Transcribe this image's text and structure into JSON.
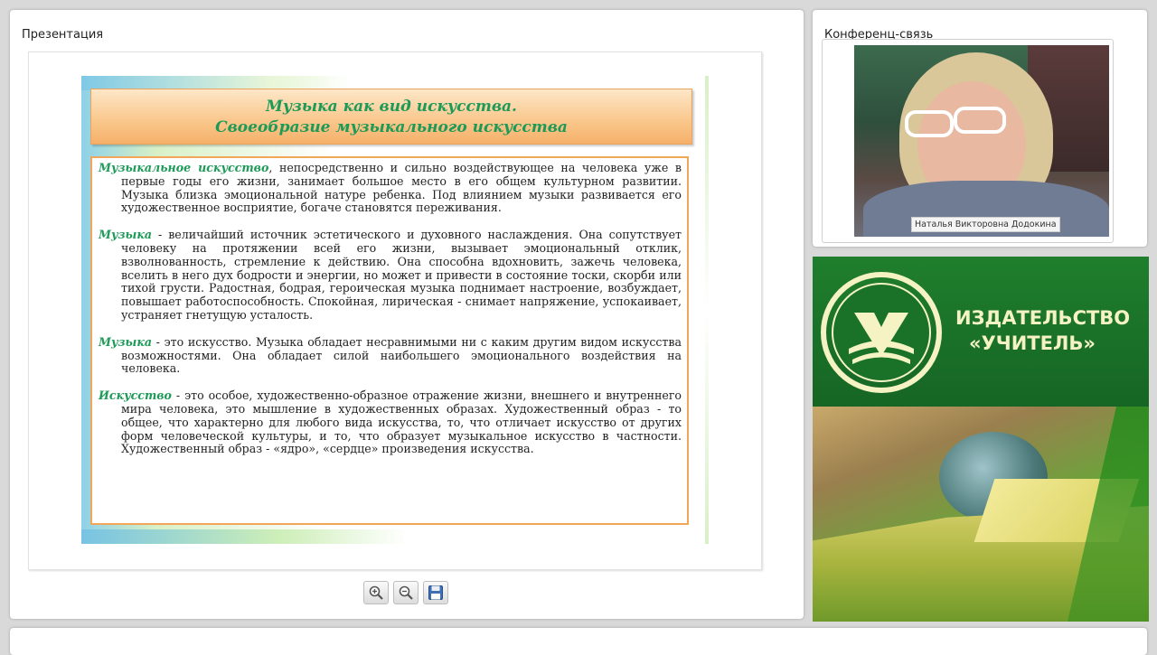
{
  "presentation": {
    "title": "Презентация",
    "slide": {
      "title_line1": "Музыка как вид искусства.",
      "title_line2": "Своеобразие музыкального искусства",
      "paragraphs": [
        {
          "term": "Музыкальное искусство",
          "text": ", непосредственно и сильно воздействующее на человека уже в первые годы его жизни, занимает большое место в его общем культурном развитии. Музыка близка эмоциональной натуре ребенка. Под влиянием музыки развивается его художественное восприятие, богаче становятся переживания."
        },
        {
          "term": "Музыка",
          "text": " - величайший источник эстетического и духовного наслаждения. Она сопутствует человеку на протяжении всей его жизни, вызывает эмоциональный отклик, взволнованность, стремление к действию. Она способна вдохновить, зажечь человека, вселить в него дух бодрости и энергии, но может и привести в состояние тоски, скорби или тихой грусти. Радостная, бодрая, героическая музыка поднимает настроение, возбуждает, повышает работоспособность. Спокойная, лирическая - снимает напряжение, успокаивает, устраняет гнетущую усталость."
        },
        {
          "term": "Музыка",
          "text": " - это искусство. Музыка обладает несравнимыми ни с каким другим видом искусства возможностями. Она обладает силой наибольшего эмоционального воздействия на человека."
        },
        {
          "term": "Искусство",
          "text": " - это особое, художественно-образное отражение жизни, внешнего и внутреннего мира человека, это мышление в художественных образах. Художественный образ - то общее, что характерно для любого вида искусства, то, что отличает искусство от других форм человеческой культуры, и то, что образует музыкальное искусство в частности. Художественный образ - «ядро», «сердце» произведения искусства."
        }
      ]
    },
    "toolbar": {
      "zoom_in_icon": "zoom-in-icon",
      "zoom_out_icon": "zoom-out-icon",
      "save_icon": "floppy-disk-icon"
    }
  },
  "conference": {
    "title": "Конференц-связь",
    "participant_name": "Наталья Викторовна Додокина"
  },
  "ad": {
    "line1": "ИЗДАТЕЛЬСТВО",
    "line2": "«УЧИТЕЛЬ»"
  },
  "colors": {
    "accent_green": "#1d9a57",
    "title_orange": "#f9c68a",
    "publisher_green": "#1f7f2d"
  }
}
